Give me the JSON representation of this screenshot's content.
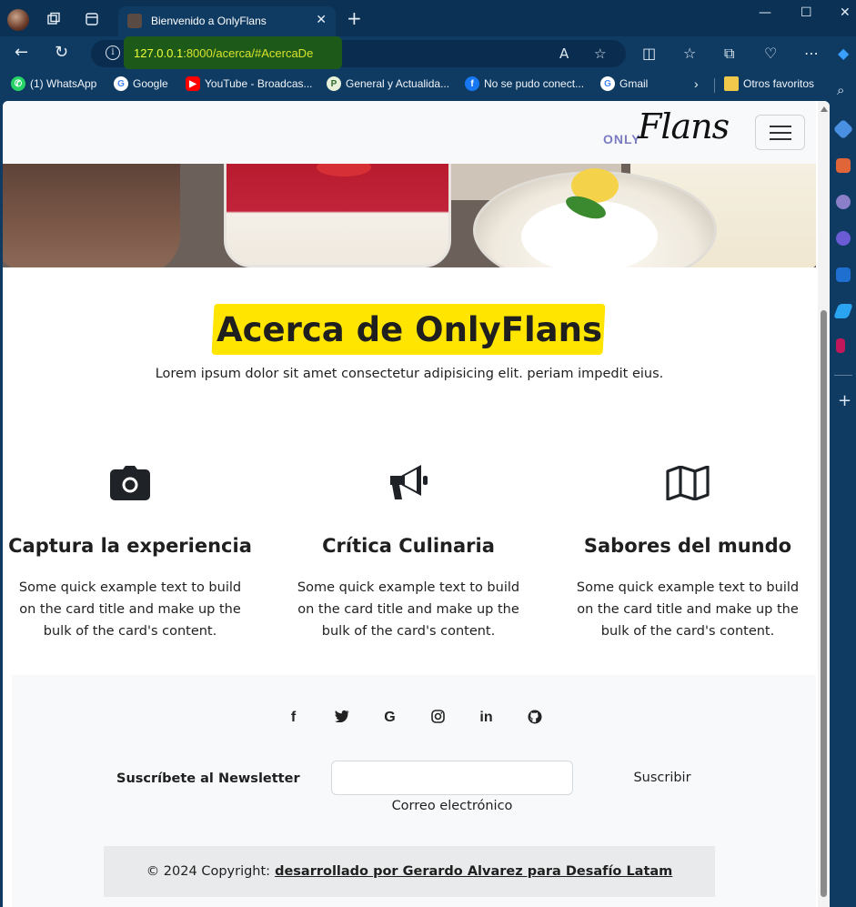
{
  "browser": {
    "tab_title": "Bienvenido a OnlyFlans",
    "url_host": "127.0.0.1",
    "url_rest": ":8000/acerca/#AcercaDe",
    "bookmarks": [
      {
        "label": "(1) WhatsApp",
        "icon": "whatsapp-icon",
        "color": "#25d366"
      },
      {
        "label": "Google",
        "icon": "google-icon",
        "color": "#4285f4"
      },
      {
        "label": "YouTube - Broadcas...",
        "icon": "youtube-icon",
        "color": "#ff0000"
      },
      {
        "label": "General y Actualida...",
        "icon": "news-icon",
        "color": "#2f6b2f"
      },
      {
        "label": "No se pudo conect...",
        "icon": "facebook-icon",
        "color": "#1877f2"
      },
      {
        "label": "Gmail",
        "icon": "google-icon",
        "color": "#4285f4"
      }
    ],
    "other_favorites": "Otros favoritos"
  },
  "site": {
    "logo_only": "ONLY",
    "logo_flans": "Flans",
    "about_title": "Acerca de OnlyFlans",
    "about_subtitle": "Lorem ipsum dolor sit amet consectetur adipisicing elit. periam impedit eius.",
    "highlight_color": "#ffe500",
    "features": [
      {
        "icon": "camera-icon",
        "title": "Captura la experiencia",
        "text": "Some quick example text to build on the card title and make up the bulk of the card's content."
      },
      {
        "icon": "megaphone-icon",
        "title": "Crítica Culinaria",
        "text": "Some quick example text to build on the card title and make up the bulk of the card's content."
      },
      {
        "icon": "map-icon",
        "title": "Sabores del mundo",
        "text": "Some quick example text to build on the card title and make up the bulk of the card's content."
      }
    ],
    "newsletter": {
      "label": "Suscríbete al Newsletter",
      "input_value": "",
      "help": "Correo electrónico",
      "button": "Suscribir"
    },
    "copyright_prefix": "© 2024 Copyright:",
    "copyright_link": "desarrollado por Gerardo Alvarez para Desafío Latam",
    "social": [
      "f",
      "twitter",
      "G",
      "instagram",
      "in",
      "github"
    ]
  }
}
